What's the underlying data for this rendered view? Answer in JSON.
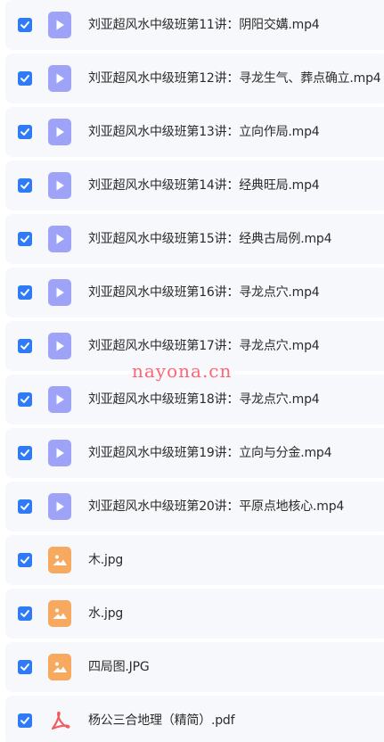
{
  "watermark": "nayona.cn",
  "colors": {
    "checkbox": "#2f7bf6",
    "video_icon": "#9ea3f8",
    "image_icon": "#f7a95f",
    "pdf_icon": "#f25c5c",
    "row_background": "#f7f8fb"
  },
  "files": [
    {
      "name": "刘亚超风水中级班第11讲：阴阳交媾.mp4",
      "type": "video",
      "icon": "play-icon",
      "checked": true
    },
    {
      "name": "刘亚超风水中级班第12讲：寻龙生气、葬点确立.mp4",
      "type": "video",
      "icon": "play-icon",
      "checked": true
    },
    {
      "name": "刘亚超风水中级班第13讲：立向作局.mp4",
      "type": "video",
      "icon": "play-icon",
      "checked": true
    },
    {
      "name": "刘亚超风水中级班第14讲：经典旺局.mp4",
      "type": "video",
      "icon": "play-icon",
      "checked": true
    },
    {
      "name": "刘亚超风水中级班第15讲：经典古局例.mp4",
      "type": "video",
      "icon": "play-icon",
      "checked": true
    },
    {
      "name": "刘亚超风水中级班第16讲：寻龙点穴.mp4",
      "type": "video",
      "icon": "play-icon",
      "checked": true
    },
    {
      "name": "刘亚超风水中级班第17讲：寻龙点穴.mp4",
      "type": "video",
      "icon": "play-icon",
      "checked": true
    },
    {
      "name": "刘亚超风水中级班第18讲：寻龙点穴.mp4",
      "type": "video",
      "icon": "play-icon",
      "checked": true
    },
    {
      "name": "刘亚超风水中级班第19讲：立向与分金.mp4",
      "type": "video",
      "icon": "play-icon",
      "checked": true
    },
    {
      "name": "刘亚超风水中级班第20讲：平原点地核心.mp4",
      "type": "video",
      "icon": "play-icon",
      "checked": true
    },
    {
      "name": "木.jpg",
      "type": "image",
      "icon": "image-icon",
      "checked": true
    },
    {
      "name": "水.jpg",
      "type": "image",
      "icon": "image-icon",
      "checked": true
    },
    {
      "name": "四局图.JPG",
      "type": "image",
      "icon": "image-icon",
      "checked": true
    },
    {
      "name": "杨公三合地理（精简）.pdf",
      "type": "pdf",
      "icon": "pdf-icon",
      "checked": true
    }
  ]
}
